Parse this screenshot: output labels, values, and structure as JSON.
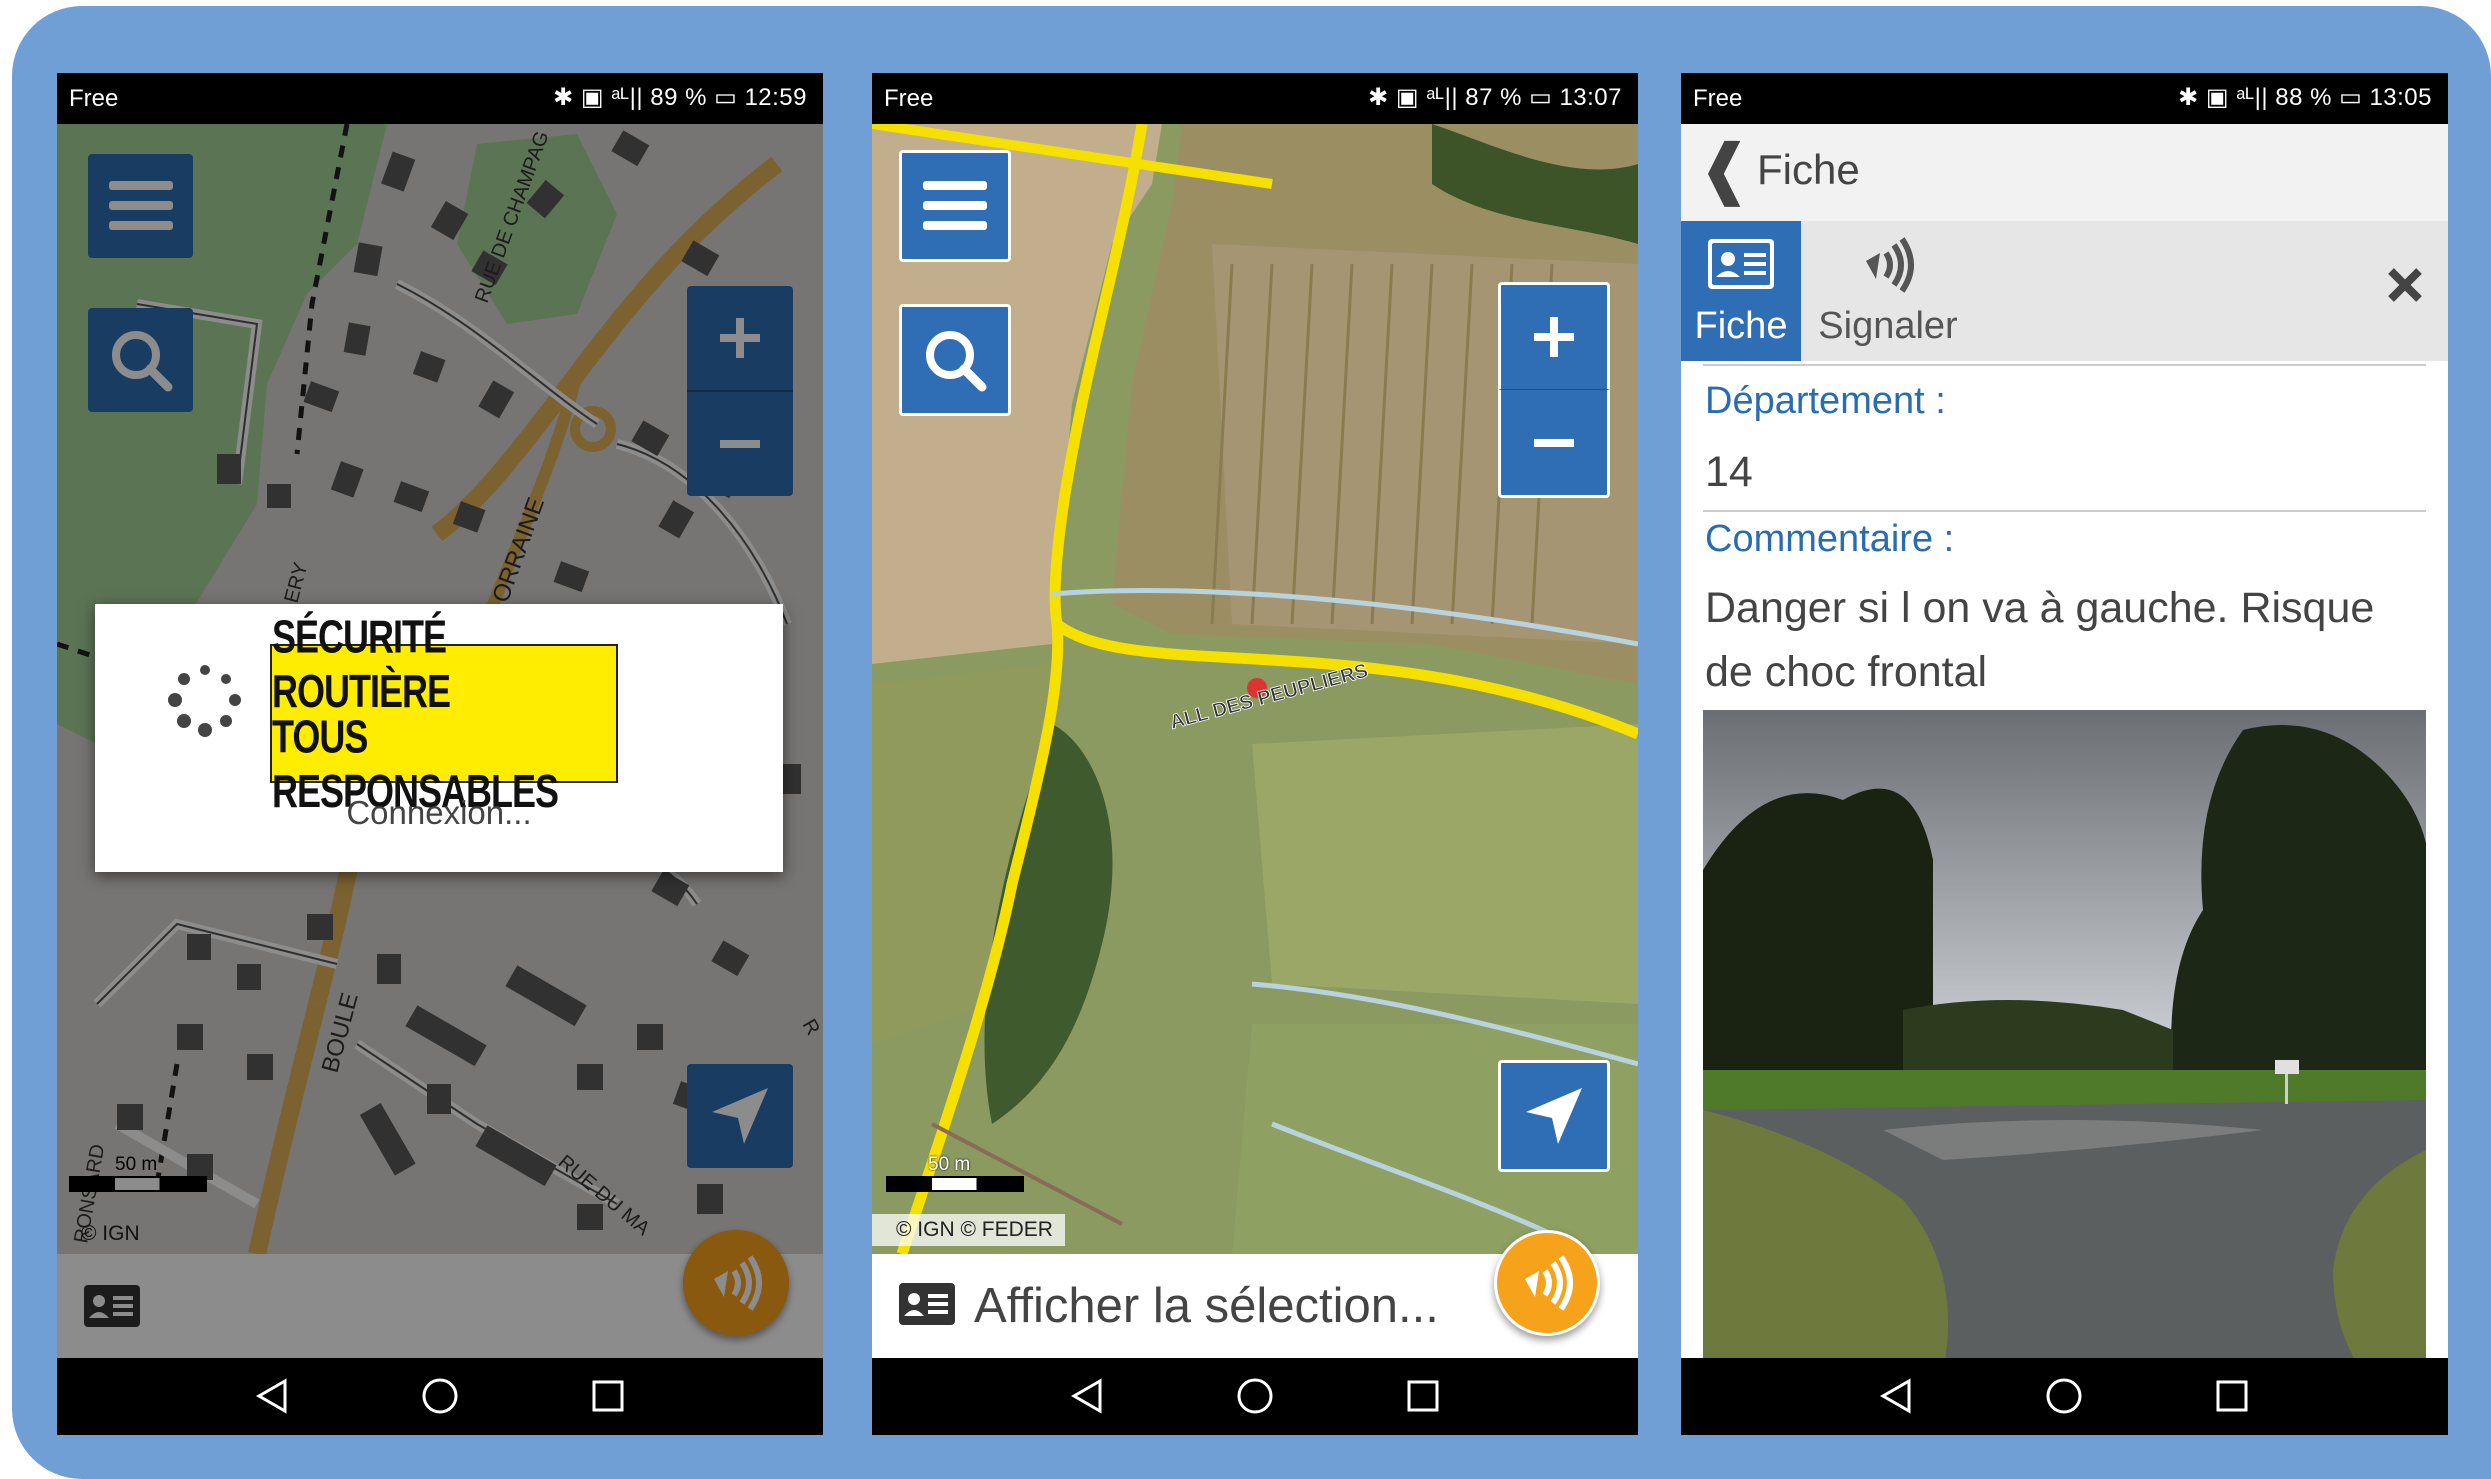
{
  "screens": [
    {
      "status": {
        "carrier": "Free",
        "battery": "89 %",
        "time": "12:59"
      },
      "map_labels": {
        "road1": "RUE DE CHAMPAG",
        "road2": "ORRAINE",
        "road3": "BOULE",
        "road4": "ERY",
        "road5": "RONSARD",
        "road6": "RUE DU MA",
        "road7": "R"
      },
      "dialog": {
        "logo_line1": "SÉCURITÉ ROUTIÈRE",
        "logo_line2": "TOUS RESPONSABLES",
        "message": "Connexion..."
      },
      "scale": "50 m",
      "attribution": "© IGN"
    },
    {
      "status": {
        "carrier": "Free",
        "battery": "87 %",
        "time": "13:07"
      },
      "map_labels": {
        "road1": "ALL DES PEUPLIERS"
      },
      "scale": "50 m",
      "attribution": "© IGN © FEDER",
      "bottom_label": "Afficher la sélection..."
    },
    {
      "status": {
        "carrier": "Free",
        "battery": "88 %",
        "time": "13:05"
      },
      "header": {
        "back": "❰",
        "title": "Fiche"
      },
      "tabs": [
        {
          "label": "Fiche",
          "active": true
        },
        {
          "label": "Signaler",
          "active": false
        }
      ],
      "fields": [
        {
          "label": "Département :",
          "value": "14"
        },
        {
          "label": "Commentaire :",
          "value": "Danger si l on va à gauche. Risque de choc frontal"
        }
      ]
    }
  ],
  "colors": {
    "frame": "#6f9fd4",
    "accent_blue": "#2f6db5",
    "fab_orange": "#f7a21b",
    "road_yellow": "#f8e11a",
    "label_blue": "#2a6cb0"
  }
}
